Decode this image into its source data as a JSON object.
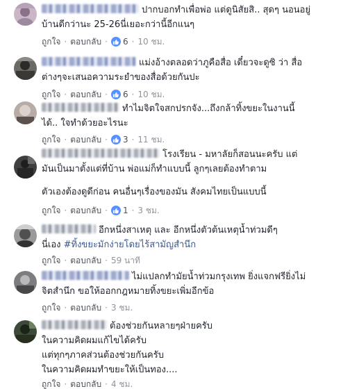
{
  "actions": {
    "like": "ถูกใจ",
    "reply": "ตอบกลับ",
    "separator": "·"
  },
  "colors": {
    "link": "#365899",
    "reaction": "#5890ff",
    "meta": "#90949c"
  },
  "comments": [
    {
      "lines": [
        "ปากบอกทำเพื่อพ่อ แต่ดูนิสัยสิ.. สุดๆ นอนอยู่",
        "บ้านดีกว่านะ 25-26นี่เยอะกว่านี้อีกแนๆ"
      ],
      "reaction_icon": "thumbs-up-icon",
      "reactions": "6",
      "time": "10 ชม."
    },
    {
      "lines": [
        "แม่งอ้างตลอดว่าภูคือสื่อ เดี๋ยวจะดูซิ ว่า สื่อ",
        "ต่างๆจะเสนอความระยำของสื่อด้วยกันปะ"
      ],
      "reaction_icon": "thumbs-up-icon",
      "reactions": "6",
      "time": "10 ชม."
    },
    {
      "lines": [
        "ทำไมจิตใจสกปรกจัง...ถึงกล้าทิ้งขยะในงานนี้",
        "ได้.. ใจทำด้วยอะไรนะ"
      ],
      "reaction_icon": "thumbs-up-icon",
      "reactions": "3",
      "time": "11 ชม."
    },
    {
      "lines": [
        "โรงเรียน - มหาลัยก็สอนนะครับ แต่",
        "มันเป็นมาตั้งแต่ที่บ้าน พ่อแม่ก็ทำแบบนี้ ลูกๆเลยต้องทำตาม"
      ],
      "extra": "ตัวเองต้องดูดีก่อน คนอื่นๆเรื่องของมัน สังคมไทยเป็นแบบนี้",
      "reaction_icon": "thumbs-up-icon",
      "reactions": "1",
      "time": "3 ชม."
    },
    {
      "lines": [
        "อีกหนึ่งสาเหตุ และ อีกหนึ่งตัวต้นเหตุน้ำท่วมดีๆ"
      ],
      "prefix": "นี่เอง ",
      "hashtag": "#ทิ้งขยะมักง่ายโดยไร้สามัญสำนึก",
      "time": "59 นาที"
    },
    {
      "lines": [
        "ไม่แปลกทำมัยน้ำท่วมกรุงเทพ ยิ่งแจกฟรียิ่งไม่",
        "จิตสำนึก ขอให้ออกกฎหมายทิ้งขยะเพิ่มอีกข้อ"
      ],
      "time": "3 ชม."
    },
    {
      "lines": [
        "ต้องช่วยกันหลายๆฝ่ายครับ",
        "ในความคิดผมแก้ไขได้ครับ",
        "แต่ทุกๆภาคส่วนต้องช่วยกันครับ",
        "ในความคิดผมทำขยะให้เป็นทอง...."
      ],
      "time": "4 ชม."
    }
  ]
}
